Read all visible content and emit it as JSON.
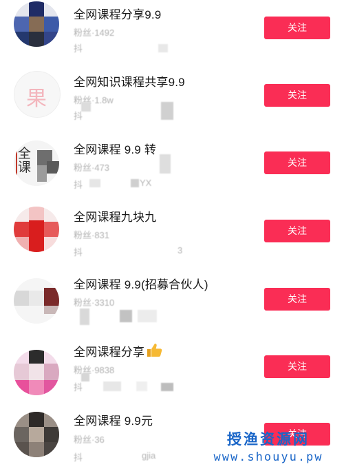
{
  "follow_label": "关注",
  "accounts": [
    {
      "name": "全网课程分享9.9",
      "fans": "粉丝·1492",
      "sub": "抖"
    },
    {
      "name": "全网知识课程共享9.9",
      "fans": "粉丝·1.8w",
      "sub": "抖"
    },
    {
      "name": "全网课程 9.9 转",
      "fans": "粉丝·473",
      "sub": "抖",
      "sub_tail": "YX"
    },
    {
      "name": "全网课程九块九",
      "fans": "粉丝·831",
      "sub": "抖",
      "sub_tail": "3"
    },
    {
      "name": "全网课程 9.9(招募合伙人)",
      "fans": "粉丝·3310",
      "sub": ""
    },
    {
      "name": "全网课程分享",
      "fans": "粉丝·9838",
      "sub": "抖"
    },
    {
      "name": "全网课程 9.9元",
      "fans": "粉丝·36",
      "sub": "抖",
      "sub_tail": "gjia"
    }
  ],
  "icons": {
    "thumb": "thumbs-up-icon"
  },
  "watermark": {
    "title": "授渔资源网",
    "url": "www.shouyu.pw"
  },
  "colors": {
    "accent": "#fa2d55",
    "watermark": "#1a66c8"
  }
}
